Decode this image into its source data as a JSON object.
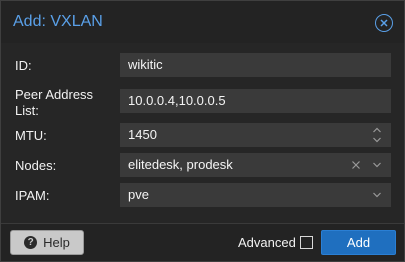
{
  "dialog": {
    "title": "Add: VXLAN"
  },
  "form": {
    "id": {
      "label": "ID:",
      "value": "wikitic"
    },
    "peers": {
      "label_line1": "Peer Address",
      "label_line2": "List:",
      "value": "10.0.0.4,10.0.0.5"
    },
    "mtu": {
      "label": "MTU:",
      "value": "1450"
    },
    "nodes": {
      "label": "Nodes:",
      "value": "elitedesk, prodesk"
    },
    "ipam": {
      "label": "IPAM:",
      "value": "pve"
    }
  },
  "footer": {
    "help_label": "Help",
    "advanced_label": "Advanced",
    "advanced_checked": false,
    "add_label": "Add"
  },
  "icons": {
    "close": "close-icon",
    "help": "question-circle-icon",
    "spinner": "spinner-icon",
    "clear": "clear-x-icon",
    "dropdown": "chevron-down-icon"
  },
  "colors": {
    "accent": "#5aa0e8",
    "primary_button": "#1f6fbf"
  }
}
